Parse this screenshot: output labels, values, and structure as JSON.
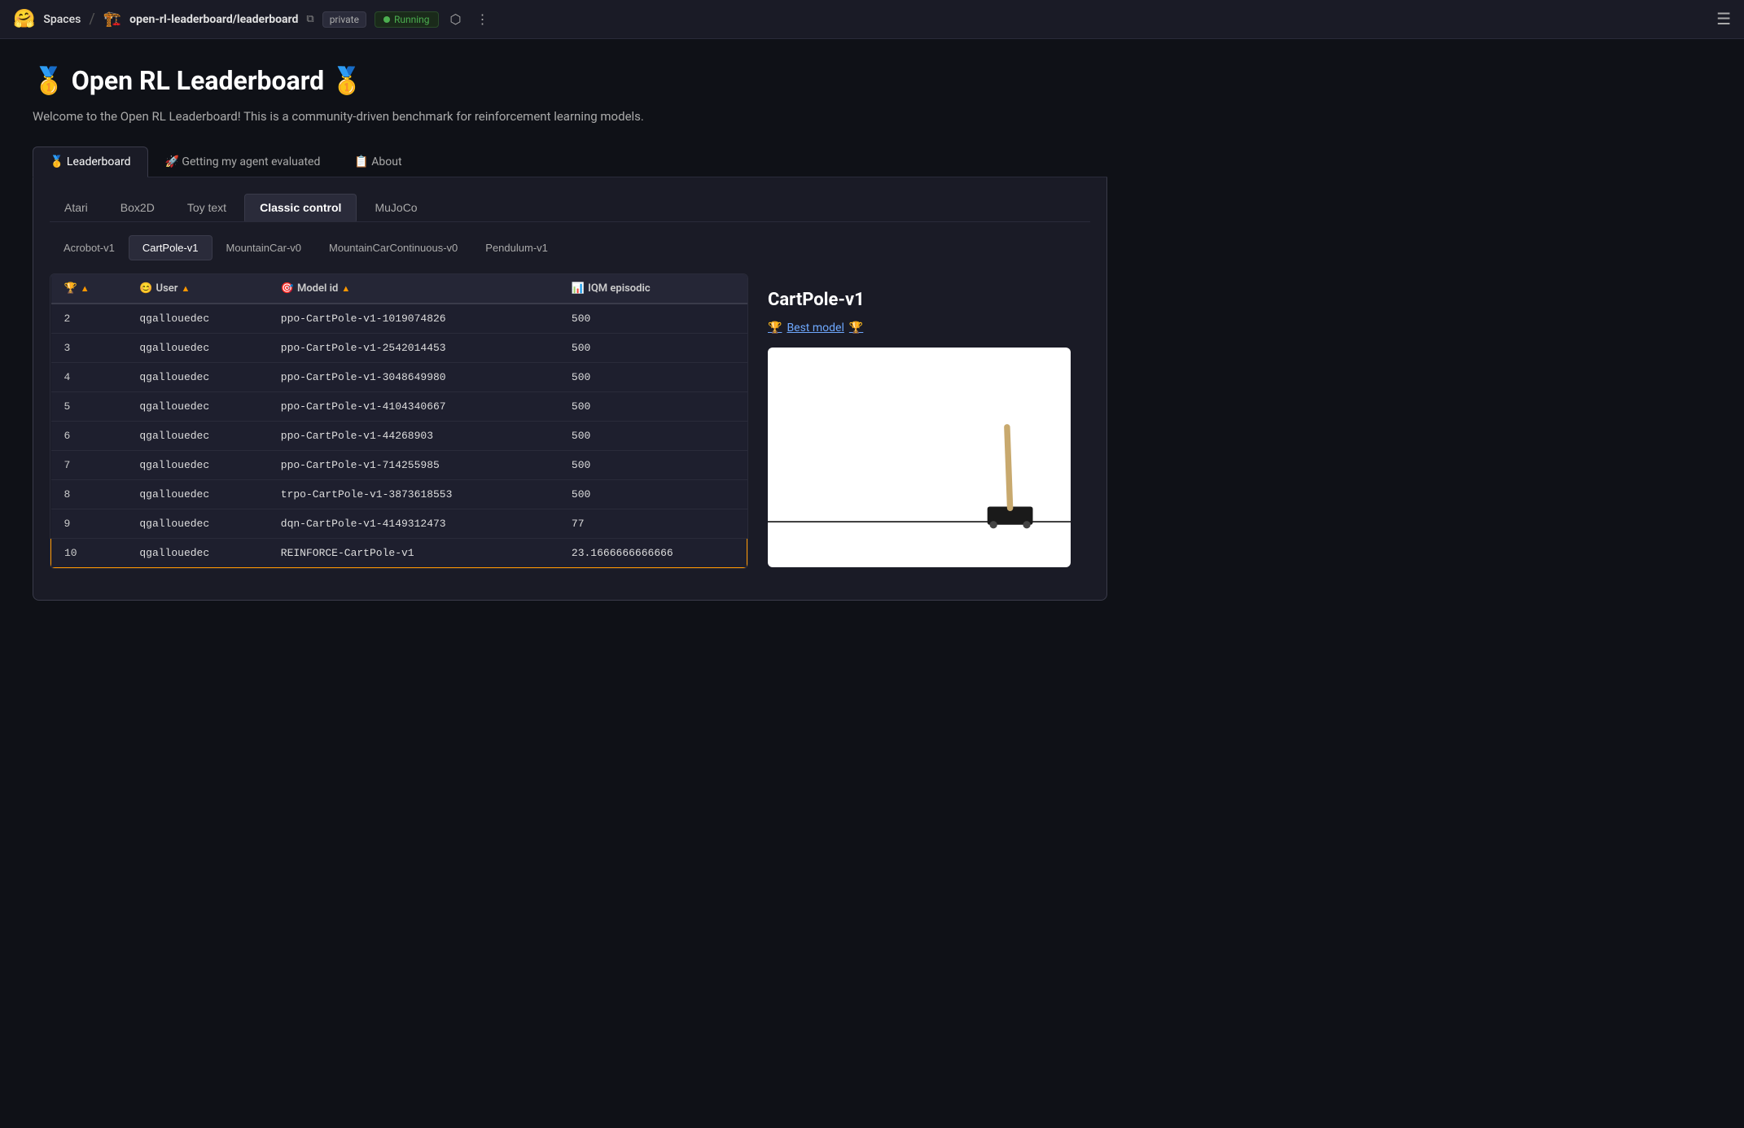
{
  "topbar": {
    "logo": "🤗",
    "spaces_label": "Spaces",
    "separator": "/",
    "repo_icon": "🏗️",
    "repo_prefix": "open-rl-leaderboard/",
    "repo_name": "leaderboard",
    "private_label": "private",
    "running_label": "Running",
    "menu_dots": "⋮",
    "hamburger": "☰"
  },
  "page": {
    "title": "🥇 Open RL Leaderboard 🥇",
    "description": "Welcome to the Open RL Leaderboard! This is a community-driven benchmark for reinforcement learning models."
  },
  "main_tabs": [
    {
      "id": "leaderboard",
      "label": "🥇 Leaderboard",
      "active": true
    },
    {
      "id": "getting-evaluated",
      "label": "🚀 Getting my agent evaluated",
      "active": false
    },
    {
      "id": "about",
      "label": "📋 About",
      "active": false
    }
  ],
  "env_tabs": [
    {
      "id": "atari",
      "label": "Atari",
      "active": false
    },
    {
      "id": "box2d",
      "label": "Box2D",
      "active": false
    },
    {
      "id": "toy-text",
      "label": "Toy text",
      "active": false
    },
    {
      "id": "classic-control",
      "label": "Classic control",
      "active": true
    },
    {
      "id": "mujoco",
      "label": "MuJoCo",
      "active": false
    }
  ],
  "sub_env_tabs": [
    {
      "id": "acrobot-v1",
      "label": "Acrobot-v1",
      "active": false
    },
    {
      "id": "cartpole-v1",
      "label": "CartPole-v1",
      "active": true
    },
    {
      "id": "mountaincar-v0",
      "label": "MountainCar-v0",
      "active": false
    },
    {
      "id": "mountaincar-cont",
      "label": "MountainCarContinuous-v0",
      "active": false
    },
    {
      "id": "pendulum-v1",
      "label": "Pendulum-v1",
      "active": false
    }
  ],
  "table": {
    "columns": [
      {
        "id": "rank",
        "label": "🏆",
        "sortable": true
      },
      {
        "id": "user",
        "label": "😊 User",
        "sortable": true
      },
      {
        "id": "model_id",
        "label": "🎯 Model id",
        "sortable": true
      },
      {
        "id": "iqm",
        "label": "📊 IQM episodic",
        "sortable": true
      }
    ],
    "rows": [
      {
        "rank": "2",
        "user": "qgallouedec",
        "model_id": "ppo-CartPole-v1-1019074826",
        "iqm": "500",
        "highlighted": false
      },
      {
        "rank": "3",
        "user": "qgallouedec",
        "model_id": "ppo-CartPole-v1-2542014453",
        "iqm": "500",
        "highlighted": false
      },
      {
        "rank": "4",
        "user": "qgallouedec",
        "model_id": "ppo-CartPole-v1-3048649980",
        "iqm": "500",
        "highlighted": false
      },
      {
        "rank": "5",
        "user": "qgallouedec",
        "model_id": "ppo-CartPole-v1-4104340667",
        "iqm": "500",
        "highlighted": false
      },
      {
        "rank": "6",
        "user": "qgallouedec",
        "model_id": "ppo-CartPole-v1-44268903",
        "iqm": "500",
        "highlighted": false
      },
      {
        "rank": "7",
        "user": "qgallouedec",
        "model_id": "ppo-CartPole-v1-714255985",
        "iqm": "500",
        "highlighted": false
      },
      {
        "rank": "8",
        "user": "qgallouedec",
        "model_id": "trpo-CartPole-v1-3873618553",
        "iqm": "500",
        "highlighted": false
      },
      {
        "rank": "9",
        "user": "qgallouedec",
        "model_id": "dqn-CartPole-v1-4149312473",
        "iqm": "77",
        "highlighted": false
      },
      {
        "rank": "10",
        "user": "qgallouedec",
        "model_id": "REINFORCE-CartPole-v1",
        "iqm": "23.1666666666666",
        "highlighted": true
      }
    ]
  },
  "side_panel": {
    "title": "CartPole-v1",
    "best_model_label": "Best model",
    "best_model_emoji_left": "🏆",
    "best_model_emoji_right": "🏆"
  }
}
